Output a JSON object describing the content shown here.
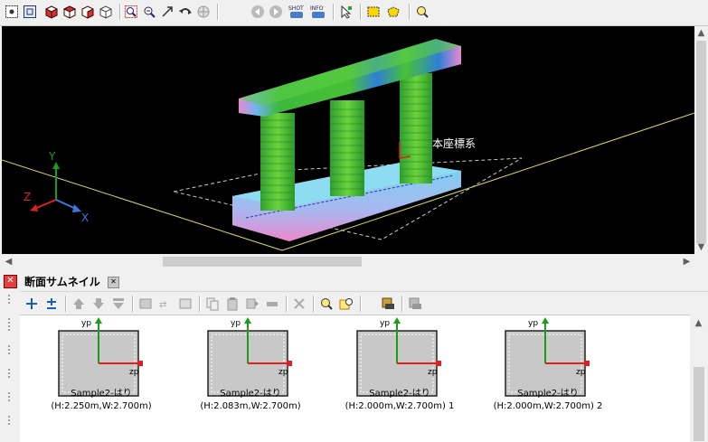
{
  "viewport": {
    "axis_y": "Y",
    "axis_z": "Z",
    "axis_x": "X",
    "coord_label": "本座標系"
  },
  "panel": {
    "tab_title": "断面サムネイル"
  },
  "thumbnails": [
    {
      "yp": "yp",
      "zp": "zp",
      "name": "Sample2-はり",
      "dims": "(H:2.250m,W:2.700m)"
    },
    {
      "yp": "yp",
      "zp": "zp",
      "name": "Sample2-はり",
      "dims": "(H:2.083m,W:2.700m)"
    },
    {
      "yp": "yp",
      "zp": "zp",
      "name": "Sample2-はり",
      "dims": "(H:2.000m,W:2.700m) 1"
    },
    {
      "yp": "yp",
      "zp": "zp",
      "name": "Sample2-はり",
      "dims": "(H:2.000m,W:2.700m) 2"
    }
  ],
  "toolbar": {
    "shot_label": "SHOT",
    "info_label": "INFO"
  },
  "colors": {
    "viewport_bg": "#000000",
    "pier_green": "#3cb83c",
    "beam_blue": "#2f7fd6",
    "base_cyan": "#7ad3ee",
    "base_pink": "#ee88cc",
    "axis_y": "#1a9e1a",
    "axis_z": "#e02020",
    "axis_x": "#3a7ae0"
  }
}
